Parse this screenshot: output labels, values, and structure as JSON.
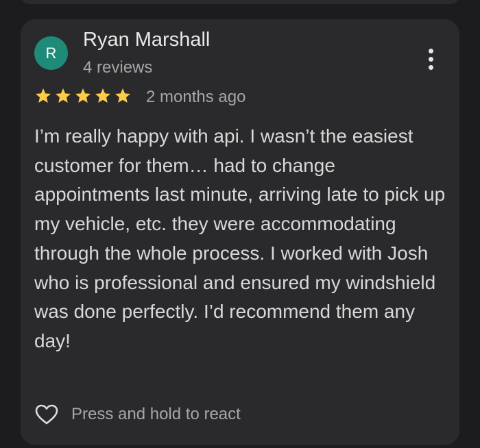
{
  "review": {
    "avatar_initial": "R",
    "avatar_color": "#1e8a78",
    "author": "Ryan Marshall",
    "review_count": "4 reviews",
    "rating": 5,
    "star_color": "#fbcb4a",
    "time": "2 months ago",
    "text": "I’m really happy with api. I wasn’t the easiest customer for them… had to change appointments last minute, arriving late to pick up my vehicle, etc. they were accommodating through the whole process. I worked with Josh who is professional and ensured my windshield was done perfectly. I’d recommend them any day!",
    "more_icon": "more-vert-icon",
    "react_icon": "heart-outline-icon",
    "react_label": "Press and hold to react"
  }
}
